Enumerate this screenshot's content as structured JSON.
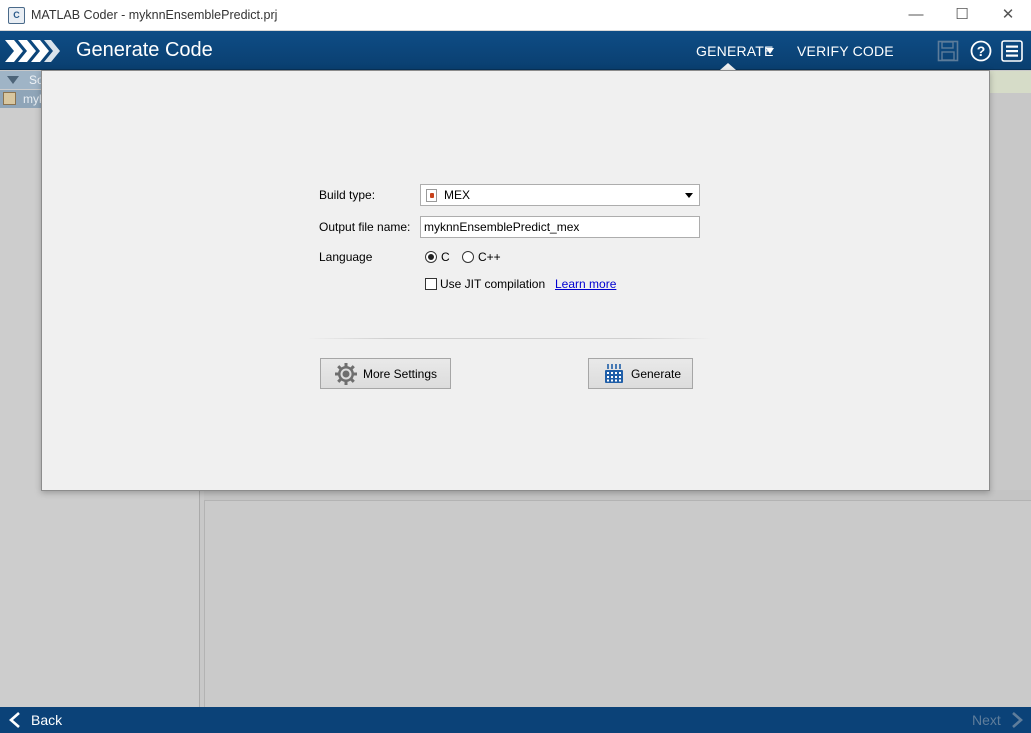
{
  "window": {
    "title": "MATLAB Coder - myknnEnsemblePredict.prj",
    "app_icon": "matlab-coder-icon",
    "controls": {
      "minimize": "—",
      "maximize": "☐",
      "close": "✕"
    }
  },
  "header": {
    "title": "Generate Code",
    "nav": [
      {
        "label": "GENERATE",
        "has_dropdown": true,
        "active": true
      },
      {
        "label": "VERIFY CODE",
        "has_dropdown": false,
        "active": false
      }
    ],
    "icons": [
      "save-icon",
      "help-icon",
      "menu-icon"
    ],
    "colors": {
      "background": "#0e4d86",
      "text": "#ffffff"
    }
  },
  "background_tree": {
    "header_text": "So",
    "row_text": "myk"
  },
  "form": {
    "build_type_label": "Build type:",
    "build_type_value": "MEX",
    "output_file_label": "Output file name:",
    "output_file_value": "myknnEnsemblePredict_mex",
    "language_label": "Language",
    "language_options": [
      {
        "label": "C",
        "checked": true
      },
      {
        "label": "C++",
        "checked": false
      }
    ],
    "jit_label": "Use JIT compilation",
    "jit_checked": false,
    "learn_more": "Learn more"
  },
  "buttons": {
    "more_settings": "More Settings",
    "generate": "Generate"
  },
  "footer": {
    "back": "Back",
    "next": "Next",
    "next_enabled": false
  }
}
